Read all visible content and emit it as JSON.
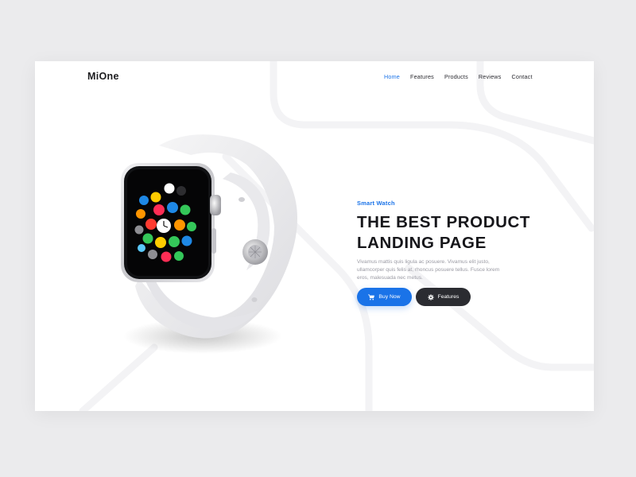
{
  "brand": {
    "logo": "MiOne"
  },
  "nav": {
    "items": [
      {
        "label": "Home",
        "active": true
      },
      {
        "label": "Features",
        "active": false
      },
      {
        "label": "Products",
        "active": false
      },
      {
        "label": "Reviews",
        "active": false
      },
      {
        "label": "Contact",
        "active": false
      }
    ]
  },
  "hero": {
    "eyebrow": "Smart Watch",
    "headline_line1": "THE BEST PRODUCT",
    "headline_line2": "LANDING PAGE",
    "description": "Vivamus mattis quis ligula ac posuere. Vivamus elit justo, ullamcorper quis felis at, rhoncus posuere tellus. Fusce lorem eros, malesuada nec metus.",
    "primary_button": {
      "label": "Buy Now",
      "icon": "cart-icon"
    },
    "secondary_button": {
      "label": "Features",
      "icon": "gear-icon"
    }
  },
  "colors": {
    "accent": "#1a73e8",
    "dark_button": "#2b2c31",
    "page_background": "#ebebed",
    "card_background": "#ffffff"
  }
}
